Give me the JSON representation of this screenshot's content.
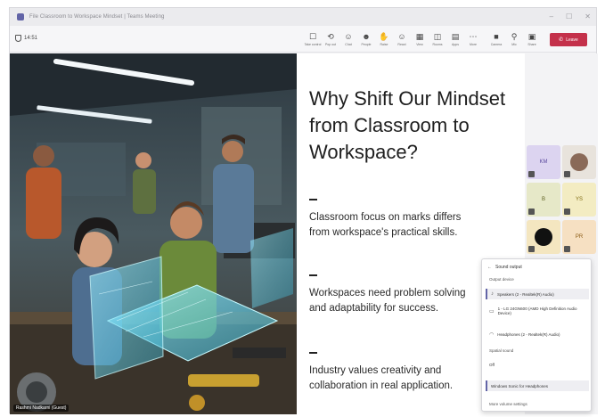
{
  "window": {
    "title": "File  Classroom to Workspace Mindset | Teams Meeting",
    "controls": [
      "–",
      "☐",
      "✕"
    ]
  },
  "toolbar": {
    "timer": "14:51",
    "tools": [
      {
        "icon": "☐",
        "label": "Take control",
        "name": "take-control"
      },
      {
        "icon": "⟲",
        "label": "Pop out",
        "name": "pop-out"
      },
      {
        "icon": "☺",
        "label": "Chat",
        "name": "chat"
      },
      {
        "icon": "☻",
        "label": "People",
        "name": "people"
      },
      {
        "icon": "✋",
        "label": "Raise",
        "name": "raise-hand"
      },
      {
        "icon": "☺",
        "label": "React",
        "name": "react"
      },
      {
        "icon": "▦",
        "label": "View",
        "name": "view"
      },
      {
        "icon": "◫",
        "label": "Rooms",
        "name": "rooms"
      },
      {
        "icon": "▤",
        "label": "Apps",
        "name": "apps"
      },
      {
        "icon": "⋯",
        "label": "More",
        "name": "more"
      }
    ],
    "devices": [
      {
        "icon": "■",
        "label": "Camera",
        "name": "camera"
      },
      {
        "icon": "⚲",
        "label": "Mic",
        "name": "mic"
      },
      {
        "icon": "▣",
        "label": "Share",
        "name": "share"
      }
    ],
    "leave_label": "Leave",
    "leave_icon": "✆"
  },
  "presenter_name": "Rashmi Nadkarni (Guest)",
  "slide": {
    "title": "Why Shift Our Mindset from Classroom to Workspace?",
    "points": [
      "Classroom focus on marks differs from workspace's practical skills.",
      "Workspaces need problem solving and adaptability for success.",
      "Industry values creativity and collaboration in real application."
    ]
  },
  "participants": [
    {
      "initials": "KM",
      "bg": "#dcd4f0",
      "fg": "#5b4a9e"
    },
    {
      "initials": "",
      "bg": "#e8e3dc",
      "fg": "#333",
      "photo": true
    },
    {
      "initials": "B",
      "bg": "#e6e8c8",
      "fg": "#5d6020"
    },
    {
      "initials": "YS",
      "bg": "#f3ecc2",
      "fg": "#7d6a10"
    },
    {
      "initials": "",
      "bg": "#f4e6c0",
      "fg": "#000",
      "dark": true
    },
    {
      "initials": "PR",
      "bg": "#f6e0c2",
      "fg": "#8a5a12"
    }
  ],
  "audio_popup": {
    "title": "Sound output",
    "output_header": "Output device",
    "outputs": [
      "Speakers (2 - Realtek(R) Audio)",
      "1 - LG 24GN600 (AMD High Definition Audio Device)",
      "Headphones (2 - Realtek(R) Audio)"
    ],
    "spatial_header": "Spatial sound",
    "spatial_value": "Off",
    "selected": "Windows Sonic for Headphones",
    "footer": "More volume settings"
  },
  "colors": {
    "accent": "#6264a7",
    "leave": "#c4314b"
  }
}
